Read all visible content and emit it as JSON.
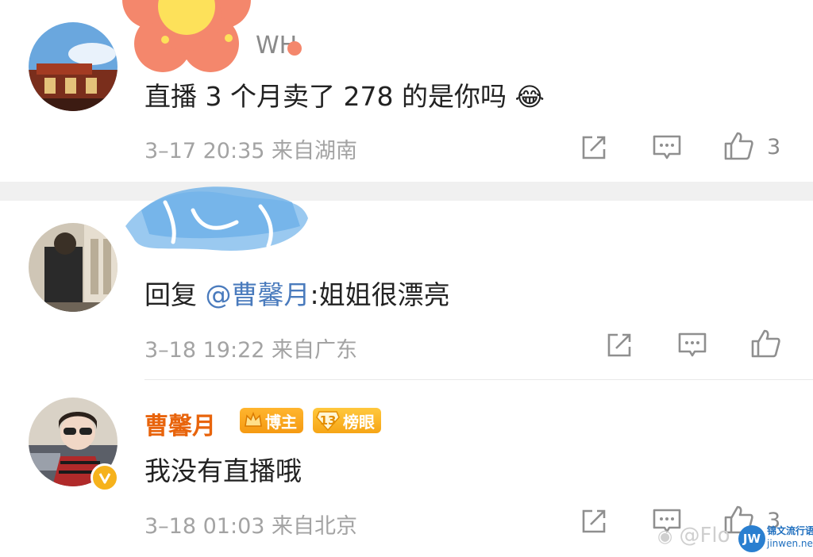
{
  "comments": [
    {
      "username": "WH",
      "text": "直播 3 个月卖了 278 的是你吗",
      "emoji": "😂",
      "meta": "3–17 20:35  来自湖南",
      "likes": "3"
    },
    {
      "text_prefix": "回复 ",
      "mention": "@曹馨月",
      "text_suffix": ":姐姐很漂亮",
      "meta": "3–18 19:22  来自广东",
      "likes": ""
    },
    {
      "username": "曹馨月",
      "badge_blogger": "博主",
      "badge_rank_num": "13",
      "badge_rank": "榜眼",
      "text": "我没有直播哦",
      "meta": "3–18 01:03  来自北京",
      "likes": "3"
    }
  ],
  "watermark": {
    "handle": "@Flo",
    "site_name": "锦文流行语",
    "site_url": "jinwen.net"
  },
  "colors": {
    "username_orange": "#e8640c",
    "mention_blue": "#4a7bbd",
    "meta_gray": "#a3a3a3",
    "icon_gray": "#8f8f8f",
    "badge_orange": "#f7a21b",
    "separator": "#f0f0f0"
  },
  "icons": [
    "share-icon",
    "comment-icon",
    "like-icon",
    "verified-icon",
    "crown-icon",
    "rank-diamond-icon"
  ]
}
